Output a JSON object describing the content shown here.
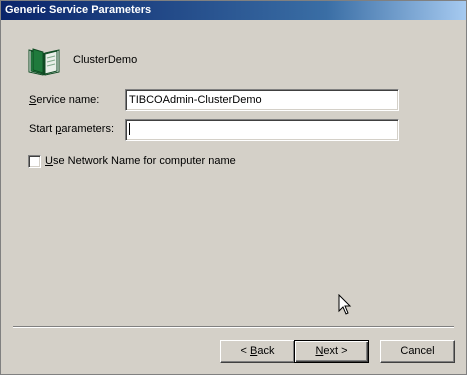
{
  "window": {
    "title": "Generic Service Parameters"
  },
  "header": {
    "icon": "open-book-icon",
    "name": "ClusterDemo"
  },
  "form": {
    "service_name": {
      "label_prefix": "",
      "label_mnemonic": "S",
      "label_rest": "ervice name:",
      "value": "TIBCOAdmin-ClusterDemo"
    },
    "start_parameters": {
      "label_prefix": "Start ",
      "label_mnemonic": "p",
      "label_rest": "arameters:",
      "value": ""
    },
    "use_network_name": {
      "label_prefix": "",
      "label_mnemonic": "U",
      "label_rest": "se Network Name for computer name",
      "checked": false
    }
  },
  "buttons": {
    "back": {
      "prefix": "< ",
      "mnemonic": "B",
      "rest": "ack"
    },
    "next": {
      "prefix": "",
      "mnemonic": "N",
      "rest": "ext >"
    },
    "cancel": {
      "label": "Cancel"
    }
  },
  "colors": {
    "face": "#d4d0c8",
    "title_start": "#0a246a",
    "title_end": "#a6caf0",
    "icon_green": "#1f7a3c"
  }
}
